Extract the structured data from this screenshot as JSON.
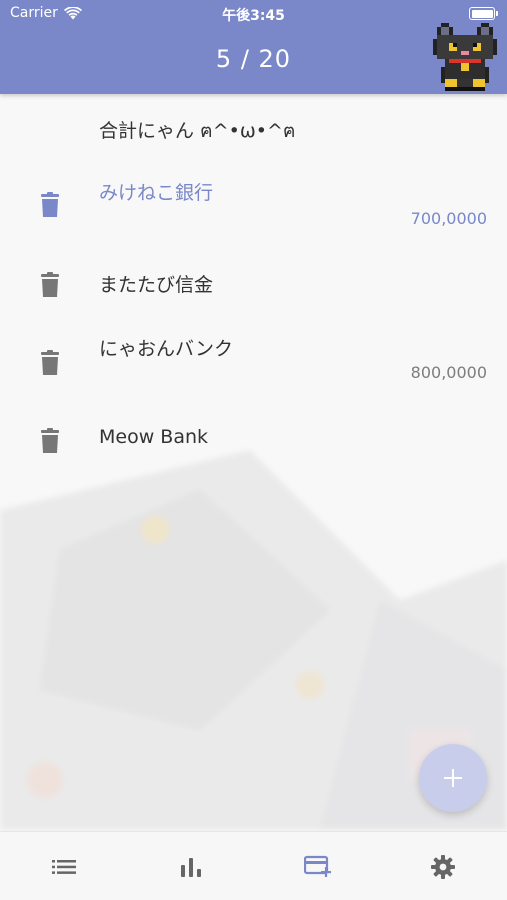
{
  "status_bar": {
    "carrier": "Carrier",
    "time": "午後3:45",
    "wifi_icon": "wifi-icon",
    "battery_icon": "battery-icon"
  },
  "header": {
    "page_counter": "5 / 20",
    "avatar_icon": "black-cat-pixel-icon",
    "color": "#7a88c9"
  },
  "list": {
    "total_label": "合計にゃん ฅ^•ω•^ฅ",
    "accounts": [
      {
        "name": "みけねこ銀行",
        "amount": "700,0000",
        "selected": true
      },
      {
        "name": "またたび信金",
        "amount": "",
        "selected": false
      },
      {
        "name": "にゃおんバンク",
        "amount": "800,0000",
        "selected": false
      },
      {
        "name": "Meow Bank",
        "amount": "",
        "selected": false
      }
    ],
    "row_icon": "trash-icon",
    "selected_color": "#7a88c9"
  },
  "fab": {
    "label": "+",
    "icon": "add-icon",
    "color": "#c9cdec"
  },
  "bottom_nav": {
    "items": [
      {
        "icon": "list-icon",
        "active": false
      },
      {
        "icon": "bar-chart-icon",
        "active": false
      },
      {
        "icon": "add-card-icon",
        "active": true
      },
      {
        "icon": "gear-icon",
        "active": false
      }
    ],
    "active_color": "#7a88c9",
    "inactive_color": "#666666"
  }
}
